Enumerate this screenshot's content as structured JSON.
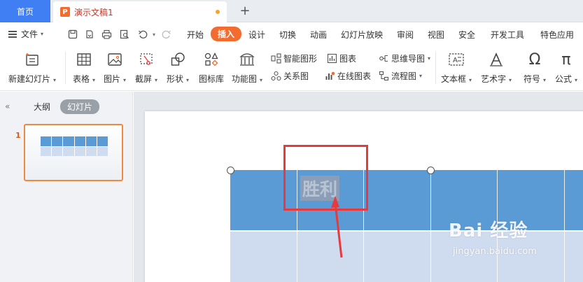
{
  "tabs": {
    "home": "首页",
    "doc_title": "演示文稿1",
    "doc_icon": "P",
    "new_tab": "+"
  },
  "menu": {
    "file": "文件",
    "items": [
      "开始",
      "插入",
      "设计",
      "切换",
      "动画",
      "幻灯片放映",
      "审阅",
      "视图",
      "安全",
      "开发工具",
      "特色应用"
    ],
    "active": "插入"
  },
  "ribbon": {
    "new_slide": "新建幻灯片",
    "table": "表格",
    "picture": "图片",
    "screenshot": "截屏",
    "shape": "形状",
    "icon_lib": "图标库",
    "function_chart": "功能图",
    "smart_graphic": "智能图形",
    "chart": "图表",
    "relation_chart": "关系图",
    "online_chart": "在线图表",
    "mind_map": "思维导图",
    "flowchart": "流程图",
    "textbox": "文本框",
    "wordart": "艺术字",
    "symbol": "符号",
    "formula": "公式"
  },
  "left_panel": {
    "outline_tab": "大纲",
    "slides_tab": "幻灯片",
    "slide_number": "1"
  },
  "slide": {
    "cell_text": "胜利"
  },
  "watermark": {
    "logo": "Bai 经验",
    "url": "jingyan.baidu.com"
  },
  "colors": {
    "accent": "#f26b2f",
    "home_tab": "#3f7ef3",
    "table_header": "#5b9bd5",
    "table_body": "#cfdbee",
    "highlight_box": "#e8393d"
  }
}
